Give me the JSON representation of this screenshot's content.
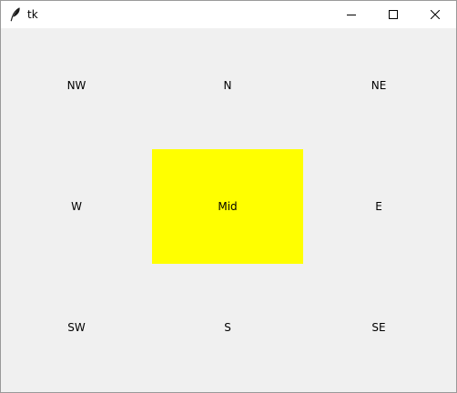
{
  "window": {
    "title": "tk",
    "icons": {
      "app": "feather-icon",
      "minimize": "minimize-icon",
      "maximize": "maximize-icon",
      "close": "close-icon"
    }
  },
  "grid": {
    "nw": "NW",
    "n": "N",
    "ne": "NE",
    "w": "W",
    "mid": "Mid",
    "e": "E",
    "sw": "SW",
    "s": "S",
    "se": "SE"
  },
  "colors": {
    "background": "#f0f0f0",
    "mid_fill": "#ffff00",
    "titlebar": "#ffffff"
  }
}
